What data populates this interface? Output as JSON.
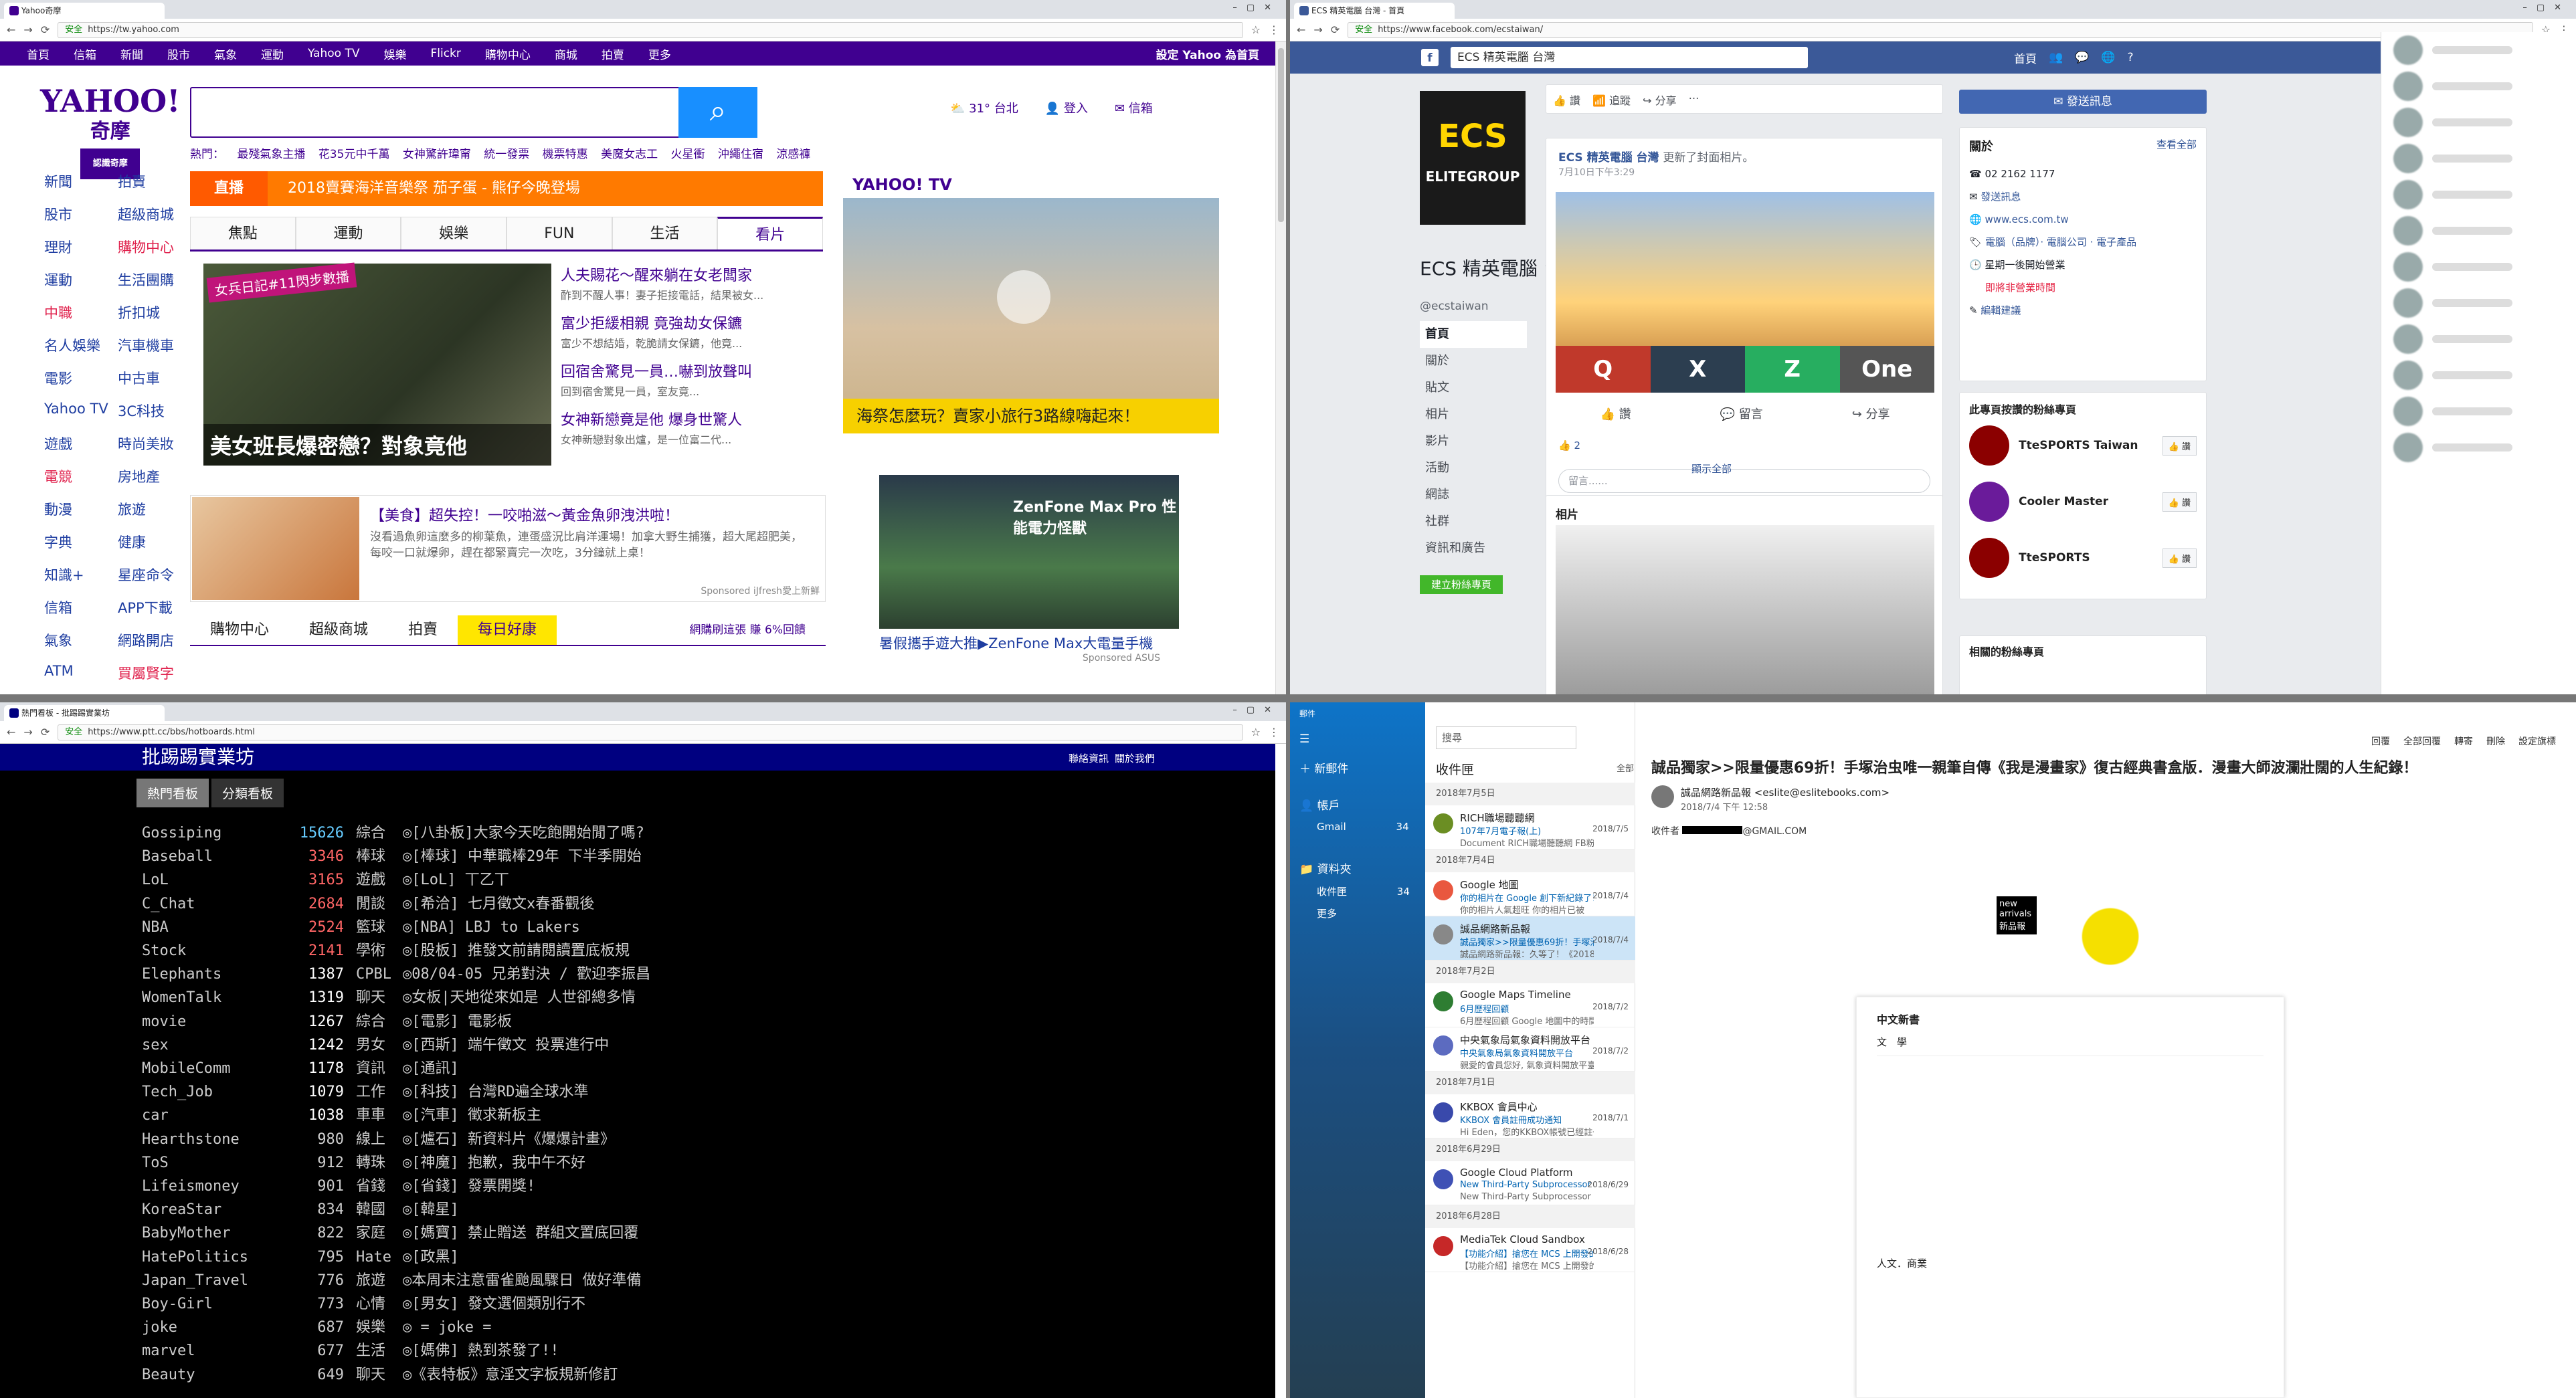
{
  "yahoo": {
    "tab_title": "Yahoo奇摩",
    "url": "https://tw.yahoo.com",
    "secure_label": "安全",
    "nav": [
      "首頁",
      "信箱",
      "新聞",
      "股市",
      "氣象",
      "運動",
      "Yahoo TV",
      "娛樂",
      "Flickr",
      "購物中心",
      "商城",
      "拍賣",
      "更多"
    ],
    "set_home": "設定 Yahoo 為首頁",
    "logo": "YAHOO!",
    "logo_sub": "奇摩",
    "logo_tag": "認識奇摩",
    "hot_label": "熱門：",
    "hot": [
      "最殘氣象主播",
      "花35元中千萬",
      "女神驚許瑋甯",
      "統一發票",
      "機票特惠",
      "美魔女志工",
      "火星衝",
      "沖繩住宿",
      "涼感褲"
    ],
    "weather_temp": "31°",
    "weather_city": "台北",
    "login": "登入",
    "mail": "信箱",
    "side": [
      [
        "新聞",
        "拍賣"
      ],
      [
        "股市",
        "超級商城"
      ],
      [
        "理財",
        "購物中心"
      ],
      [
        "運動",
        "生活團購"
      ],
      [
        "中職",
        "折扣城"
      ],
      [
        "名人娛樂",
        "汽車機車"
      ],
      [
        "電影",
        "中古車"
      ],
      [
        "Yahoo TV",
        "3C科技"
      ],
      [
        "遊戲",
        "時尚美妝"
      ],
      [
        "電競",
        "房地產"
      ],
      [
        "動漫",
        "旅遊"
      ],
      [
        "字典",
        "健康"
      ],
      [
        "知識+",
        "星座命令"
      ],
      [
        "信箱",
        "APP下載"
      ],
      [
        "氣象",
        "網路開店"
      ],
      [
        "ATM",
        "買屬賢字"
      ]
    ],
    "live_label": "直播",
    "live_text": "2018賣賽海洋音樂祭 茄子蛋 - 熊仔今晚登場",
    "tabs": [
      "焦點",
      "運動",
      "娛樂",
      "FUN",
      "生活",
      "看片"
    ],
    "story_tag": "女兵日記#11閃步數播",
    "story_caption": "美女班長爆密戀？對象竟他",
    "headlines": [
      {
        "t": "人夫賜花～醒來躺在女老闆家",
        "p": "酢到不醒人事！妻子拒接電話，結果被女..."
      },
      {
        "t": "富少拒緩相親 竟強劫女保鑣",
        "p": "富少不想結婚，乾脆請女保鑣，他竟..."
      },
      {
        "t": "回宿舍驚見一員…嚇到放聲叫",
        "p": "回到宿舍驚見一員，室友竟..."
      },
      {
        "t": "女神新戀竟是他 爆身世驚人",
        "p": "女神新戀對象出爐，是一位富二代..."
      }
    ],
    "video_brand": "YAHOO! TV",
    "video_caption": "海祭怎麼玩？賣家小旅行3路線嗨起來！",
    "food_title": "【美食】超失控！一咬啪滋～黃金魚卵洩洪啦！",
    "food_desc": "沒看過魚卵這麼多的柳葉魚，連蛋盛況比肩洋運場！加拿大野生捕獲，超大尾超肥美，每咬一口就爆卵，趕在都緊賣完一次吃，3分鐘就上桌！",
    "food_sponsor": "Sponsored iJfresh愛上新鮮",
    "ad_title": "ZenFone Max Pro 性能電力怪獸",
    "ad_caption": "暑假攜手遊大推▶ZenFone Max大電量手機",
    "ad_sponsor": "Sponsored ASUS",
    "shop_tabs": [
      "購物中心",
      "超級商城",
      "拍賣",
      "每日好康"
    ],
    "shop_note": "網購刷這張 賺 6%回饋"
  },
  "facebook": {
    "tab_title": "ECS 精英電腦 台灣 - 首頁",
    "url": "https://www.facebook.com/ecstaiwan/",
    "secure_label": "安全",
    "search": "ECS 精英電腦 台灣",
    "home": "首頁",
    "cover_logo": "ECS",
    "cover_sub": "ELITEGROUP",
    "page_name": "ECS 精英電腦 台灣",
    "handle": "@ecstaiwan",
    "menu": [
      "首頁",
      "關於",
      "貼文",
      "相片",
      "影片",
      "活動",
      "網誌",
      "社群",
      "資訊和廣告"
    ],
    "create_page": "建立粉絲專頁",
    "actions": [
      "讚",
      "追蹤",
      "分享"
    ],
    "send_message": "發送訊息",
    "post_author": "ECS 精英電腦 台灣",
    "post_action": "更新了封面相片。",
    "post_date": "7月10日下午3:29",
    "post_tiles": [
      "Q",
      "X",
      "Z",
      "One"
    ],
    "post_buttons": [
      "讚",
      "留言",
      "分享"
    ],
    "post_likes": "2",
    "comment_placeholder": "留言......",
    "see_all": "顯示全部",
    "photos_title": "相片",
    "about_title": "關於",
    "about_edit": "查看全部",
    "about_rows": [
      "02 2162 1177",
      "發送訊息",
      "www.ecs.com.tw",
      "電腦（品牌）· 電腦公司 · 電子產品",
      "星期一後開始營業",
      "即將非營業時間",
      "編輯建議"
    ],
    "liked_title": "此專頁按讚的粉絲專頁",
    "liked": [
      "TteSPORTS Taiwan",
      "Cooler Master",
      "TteSPORTS"
    ],
    "like_btn": "讚",
    "related_title": "相關的粉絲專頁"
  },
  "ptt": {
    "tab_title": "熱門看板 - 批踢踢實業坊",
    "url": "https://www.ptt.cc/bbs/hotboards.html",
    "secure_label": "安全",
    "title": "批踢踢實業坊",
    "links": "聯絡資訊  關於我們",
    "tabs": [
      "熱門看板",
      "分類看板"
    ],
    "boards": [
      [
        "Gossiping",
        "15626",
        "綜合",
        "◎[八卦板]大家今天吃飽開始閒了嗎?"
      ],
      [
        "Baseball",
        "3346",
        "棒球",
        "◎[棒球] 中華職棒29年 下半季開始"
      ],
      [
        "LoL",
        "3165",
        "遊戲",
        "◎[LoL] 丅乙丅"
      ],
      [
        "C_Chat",
        "2684",
        "閒談",
        "◎[希洽] 七月徵文x春番觀後"
      ],
      [
        "NBA",
        "2524",
        "籃球",
        "◎[NBA] LBJ to Lakers"
      ],
      [
        "Stock",
        "2141",
        "學術",
        "◎[股板] 推發文前請閱讀置底板規"
      ],
      [
        "Elephants",
        "1387",
        "CPBL",
        "◎08/04-05 兄弟對決 / 歡迎李振昌"
      ],
      [
        "WomenTalk",
        "1319",
        "聊天",
        "◎女板|天地從來如是 人世卻總多情"
      ],
      [
        "movie",
        "1267",
        "綜合",
        "◎[電影] 電影板"
      ],
      [
        "sex",
        "1242",
        "男女",
        "◎[西斯] 端午徵文 投票進行中"
      ],
      [
        "MobileComm",
        "1178",
        "資訊",
        "◎[通訊]"
      ],
      [
        "Tech_Job",
        "1079",
        "工作",
        "◎[科技] 台灣RD遍全球水準"
      ],
      [
        "car",
        "1038",
        "車車",
        "◎[汽車] 徵求新板主"
      ],
      [
        "Hearthstone",
        "980",
        "線上",
        "◎[爐石] 新資料片《爆爆計畫》"
      ],
      [
        "ToS",
        "912",
        "轉珠",
        "◎[神魔] 抱歉，我中午不好"
      ],
      [
        "Lifeismoney",
        "901",
        "省錢",
        "◎[省錢] 發票開獎!"
      ],
      [
        "KoreaStar",
        "834",
        "韓國",
        "◎[韓星]"
      ],
      [
        "BabyMother",
        "822",
        "家庭",
        "◎[媽寶] 禁止贈送 群組文置底回覆"
      ],
      [
        "HatePolitics",
        "795",
        "Hate",
        "◎[政黑]"
      ],
      [
        "Japan_Travel",
        "776",
        "旅遊",
        "◎本周末注意雷雀颱風驟日 做好準備"
      ],
      [
        "Boy-Girl",
        "773",
        "心情",
        "◎[男女] 發文選個類別行不"
      ],
      [
        "joke",
        "687",
        "娛樂",
        "◎ = joke ="
      ],
      [
        "marvel",
        "677",
        "生活",
        "◎[媽佛] 熱到茶發了!!"
      ],
      [
        "Beauty",
        "649",
        "聊天",
        "◎《表特板》意淫文字板規新修訂"
      ]
    ]
  },
  "mail": {
    "app_title": "郵件",
    "new_mail": "新郵件",
    "accounts": "帳戶",
    "gmail": "Gmail",
    "gmail_count": "34",
    "folders": "資料夾",
    "inbox": "收件匣",
    "inbox_count": "34",
    "more": "更多",
    "search": "搜尋",
    "list_title": "收件匣",
    "filter": "全部",
    "groups": [
      {
        "date": "2018年7月5日",
        "items": [
          {
            "from": "RICH職場聽聽網",
            "subj": "107年7月電子報(上)",
            "prev": "Document RICH職場聽聽網 FB粉絲",
            "dt": "2018/7/5",
            "color": "#6b8e23",
            "sel": false
          }
        ]
      },
      {
        "date": "2018年7月4日",
        "items": [
          {
            "from": "Google 地圖",
            "subj": "你的相片在 Google 創下新紀錄了！",
            "prev": "你的相片人氣超旺 你的相片已被",
            "dt": "2018/7/4",
            "color": "#e9573f",
            "sel": false
          },
          {
            "from": "誠品網路新品報",
            "subj": "誠品獨家>>限量優惠69折！手塚治",
            "prev": "誠品網路新品報：久等了！《2018",
            "dt": "2018/7/4",
            "color": "#888",
            "sel": true
          }
        ]
      },
      {
        "date": "2018年7月2日",
        "items": [
          {
            "from": "Google Maps Timeline",
            "subj": "6月歷程回顧",
            "prev": "6月歷程回顧 Google 地圖中的時間",
            "dt": "2018/7/2",
            "color": "#2e7d32",
            "sel": false
          },
          {
            "from": "中央氣象局氣象資料開放平台",
            "subj": "中央氣象局氣象資料開放平台",
            "prev": "親愛的會員您好, 氣象資料開放平臺！",
            "dt": "2018/7/2",
            "color": "#5c6bc0",
            "sel": false
          }
        ]
      },
      {
        "date": "2018年7月1日",
        "items": [
          {
            "from": "KKBOX 會員中心",
            "subj": "KKBOX 會員註冊成功通知",
            "prev": "Hi Eden，您的KKBOX帳號已經註冊",
            "dt": "2018/7/1",
            "color": "#3949ab",
            "sel": false
          }
        ]
      },
      {
        "date": "2018年6月29日",
        "items": [
          {
            "from": "Google Cloud Platform",
            "subj": "New Third-Party Subprocessor fo",
            "prev": "New Third-Party Subprocessor fo",
            "dt": "2018/6/29",
            "color": "#3f51b5",
            "sel": false
          }
        ]
      },
      {
        "date": "2018年6月28日",
        "items": [
          {
            "from": "MediaTek Cloud Sandbox",
            "subj": "【功能介紹】搶您在 MCS 上開發的",
            "prev": "【功能介紹】搶您在 MCS 上開發的",
            "dt": "2018/6/28",
            "color": "#c62828",
            "sel": false
          }
        ]
      }
    ],
    "toolbar": [
      "回覆",
      "全部回覆",
      "轉寄",
      "刪除",
      "設定旗標"
    ],
    "subject": "誠品獨家>>限量優惠69折！手塚治虫唯一親筆自傳《我是漫畫家》復古經典書盒版．漫畫大師波瀾壯闊的人生紀錄！",
    "from": "誠品網路新品報 <eslite@eslitebooks.com>",
    "date": "2018/7/4 下午 12:58",
    "to_label": "收件者",
    "to_suffix": "@GMAIL.COM",
    "banner": "new arrivals 新品報",
    "body_title": "中文新書",
    "body_sub": "文　學",
    "body_section": "人文．商業"
  }
}
